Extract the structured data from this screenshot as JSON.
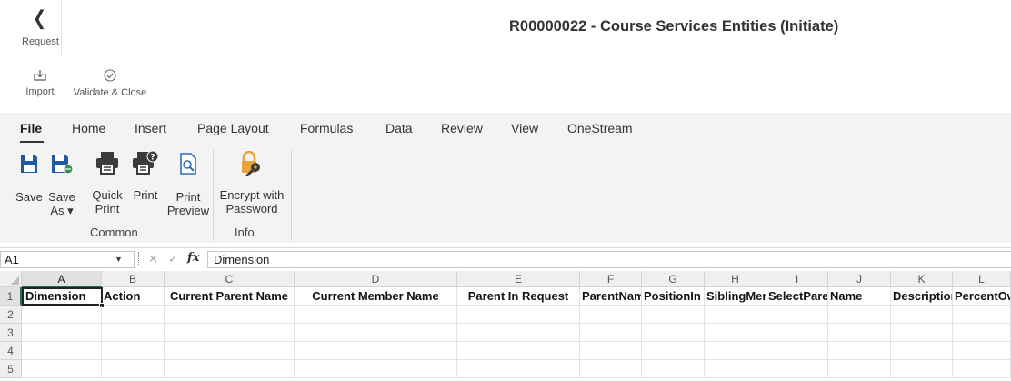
{
  "header": {
    "back_label": "Request",
    "title": "R00000022  - Course Services Entities (Initiate)"
  },
  "toolbar": {
    "import_label": "Import",
    "validate_label": "Validate & Close"
  },
  "ribbon": {
    "tabs": [
      "File",
      "Home",
      "Insert",
      "Page Layout",
      "Formulas",
      "Data",
      "Review",
      "View",
      "OneStream"
    ],
    "active_tab": "File",
    "buttons": {
      "save": [
        "Save"
      ],
      "save_as": [
        "Save",
        "As ▾"
      ],
      "quick_print": [
        "Quick",
        "Print"
      ],
      "print": [
        "Print"
      ],
      "print_preview": [
        "Print",
        "Preview"
      ],
      "encrypt": [
        "Encrypt with",
        "Password"
      ]
    },
    "groups": {
      "common": "Common",
      "info": "Info"
    }
  },
  "formula_bar": {
    "name_box": "A1",
    "fx_symbol": "fx",
    "value": "Dimension"
  },
  "sheet": {
    "columns": [
      "A",
      "B",
      "C",
      "D",
      "E",
      "F",
      "G",
      "H",
      "I",
      "J",
      "K",
      "L"
    ],
    "rows": [
      "1",
      "2",
      "3",
      "4",
      "5"
    ],
    "headers": [
      "Dimension",
      "Action",
      "Current Parent Name",
      "Current Member Name",
      "Parent In Request",
      "ParentName",
      "PositionIn",
      "SiblingMember",
      "SelectParent",
      "Name",
      "Description",
      "PercentOwnership"
    ],
    "active_cell": "A1"
  },
  "colors": {
    "ribbon_bg": "#f3f3f3",
    "save_blue": "#1f5aa6",
    "print_dark": "#3b3b3b",
    "preview_blue": "#2f6fb6",
    "lock_orange": "#e8a23a",
    "selection_green": "#217346"
  }
}
